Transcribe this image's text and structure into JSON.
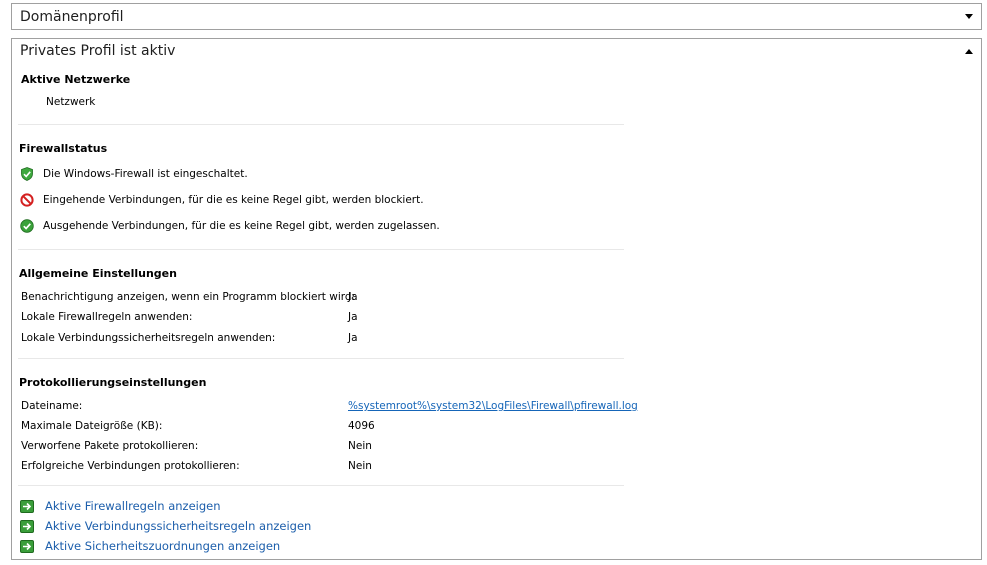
{
  "domain_profile": {
    "title": "Domänenprofil"
  },
  "private_profile": {
    "title": "Privates Profil ist aktiv"
  },
  "active_networks": {
    "heading": "Aktive Netzwerke",
    "network": "Netzwerk"
  },
  "firewall_status": {
    "heading": "Firewallstatus",
    "items": [
      {
        "icon": "green-shield-check-icon",
        "text": "Die Windows-Firewall ist eingeschaltet."
      },
      {
        "icon": "red-block-icon",
        "text": "Eingehende Verbindungen, für die es keine Regel gibt, werden blockiert."
      },
      {
        "icon": "green-check-icon",
        "text": "Ausgehende Verbindungen, für die es keine Regel gibt, werden zugelassen."
      }
    ]
  },
  "general_settings": {
    "heading": "Allgemeine Einstellungen",
    "rows": [
      {
        "label": "Benachrichtigung anzeigen, wenn ein Programm blockiert wird:",
        "value": "Ja"
      },
      {
        "label": "Lokale Firewallregeln anwenden:",
        "value": "Ja"
      },
      {
        "label": "Lokale Verbindungssicherheitsregeln anwenden:",
        "value": "Ja"
      }
    ]
  },
  "logging_settings": {
    "heading": "Protokollierungseinstellungen",
    "rows": [
      {
        "label": "Dateiname:",
        "value": "%systemroot%\\system32\\LogFiles\\Firewall\\pfirewall.log"
      },
      {
        "label": "Maximale Dateigröße (KB):",
        "value": "4096"
      },
      {
        "label": "Verworfene Pakete protokollieren:",
        "value": "Nein"
      },
      {
        "label": "Erfolgreiche Verbindungen protokollieren:",
        "value": "Nein"
      }
    ]
  },
  "links": [
    "Aktive Firewallregeln anzeigen",
    "Aktive Verbindungssicherheitsregeln anzeigen",
    "Aktive Sicherheitszuordnungen anzeigen"
  ],
  "colors": {
    "link": "#1c5eab",
    "green": "#2e9b2e",
    "red": "#d42020",
    "border": "#a0a0a0"
  }
}
